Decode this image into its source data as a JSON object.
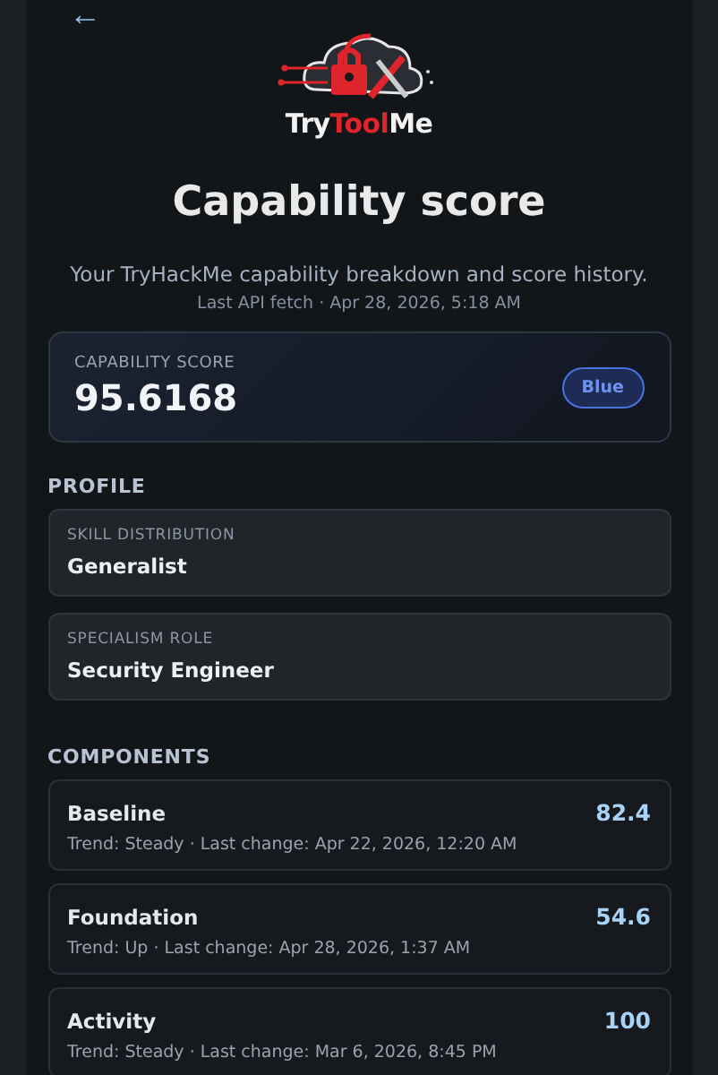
{
  "back_button": {
    "label": "←"
  },
  "logo": {
    "parts": [
      {
        "text": "Try",
        "kind": "plain"
      },
      {
        "text": "Tool",
        "kind": "accent"
      },
      {
        "text": "Me",
        "kind": "plain"
      }
    ]
  },
  "title": "Capability score",
  "subtitle": "Your TryHackMe capability breakdown and score history.",
  "last_fetch": "Last API fetch · Apr 28, 2026, 5:18 AM",
  "score_card": {
    "label": "CAPABILITY SCORE",
    "value": "95.6168",
    "badge": "Blue"
  },
  "profile": {
    "heading": "PROFILE",
    "items": [
      {
        "label": "SKILL DISTRIBUTION",
        "value": "Generalist"
      },
      {
        "label": "SPECIALISM ROLE",
        "value": "Security Engineer"
      }
    ]
  },
  "components": {
    "heading": "COMPONENTS",
    "items": [
      {
        "name": "Baseline",
        "score": "82.4",
        "detail": "Trend: Steady · Last change: Apr 22, 2026, 12:20 AM"
      },
      {
        "name": "Foundation",
        "score": "54.6",
        "detail": "Trend: Up · Last change: Apr 28, 2026, 1:37 AM"
      },
      {
        "name": "Activity",
        "score": "100",
        "detail": "Trend: Steady · Last change: Mar 6, 2026, 8:45 PM"
      }
    ]
  }
}
